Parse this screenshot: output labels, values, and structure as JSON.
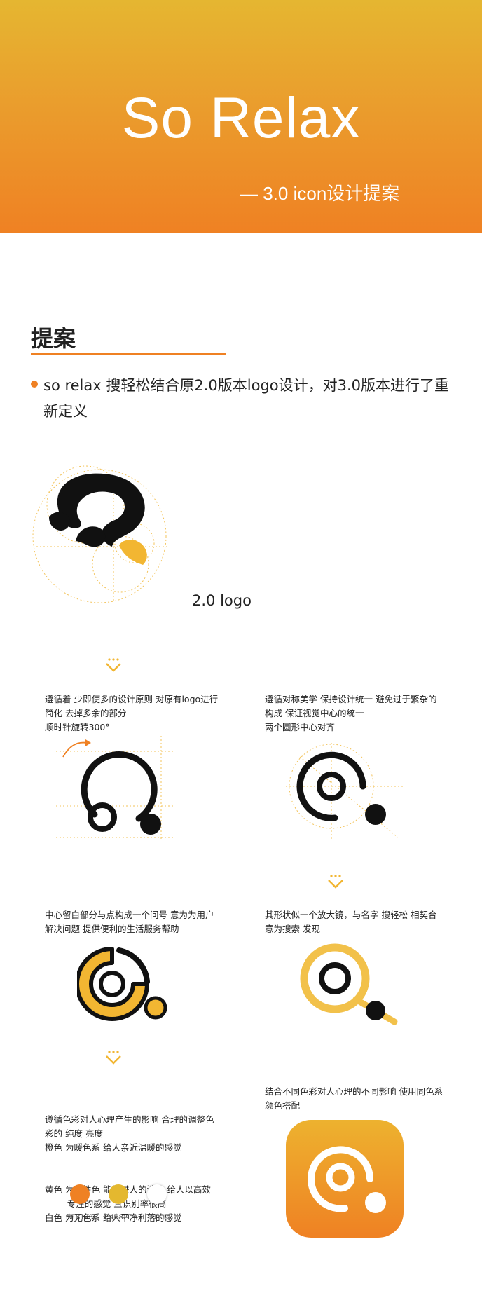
{
  "hero": {
    "title": "So Relax",
    "subtitle": "— 3.0 icon设计提案",
    "gradient": [
      "#E5B631",
      "#EF8123"
    ]
  },
  "section": {
    "title": "提案",
    "lead": "so relax 搜轻松结合原2.0版本logo设计，对3.0版本进行了重新定义"
  },
  "logo_caption": "2.0 logo",
  "steps": [
    {
      "id": "s1",
      "lines": [
        "遵循着 少即使多的设计原则 对原有logo进行",
        "简化 去掉多余的部分",
        "顺时针旋转300°"
      ]
    },
    {
      "id": "s2",
      "lines": [
        "遵循对称美学 保持设计统一 避免过于繁杂的",
        "构成 保证视觉中心的统一",
        "两个圆形中心对齐"
      ]
    },
    {
      "id": "s3",
      "lines": [
        "中心留白部分与点构成一个问号 意为为用户",
        "解决问题 提供便利的生活服务帮助"
      ]
    },
    {
      "id": "s4",
      "lines": [
        "其形状似一个放大镜，与名字 搜轻松 相契合",
        "意为搜索 发现"
      ]
    },
    {
      "id": "s5",
      "lines": [
        "遵循色彩对人心理产生的影响 合理的调整色",
        "彩的 纯度 亮度",
        "橙色 为暖色系 给人亲近温暖的感觉",
        "黄色 为中性色 能促进人的消费 给人以高效",
        "        专注的感觉 且识别率很高",
        "白色 为无色系 给人干净利落的感觉"
      ]
    },
    {
      "id": "s6",
      "lines": [
        "结合不同色彩对人心理的不同影响 使用同色系",
        "颜色搭配"
      ]
    }
  ],
  "palette": [
    {
      "hex": "EF8123",
      "color": "#EF8123"
    },
    {
      "hex": "E4B82F",
      "color": "#E4B82F"
    },
    {
      "hex": "FFFFFF",
      "color": "#FFFFFF"
    }
  ],
  "colors": {
    "orange": "#EF8123",
    "yellow": "#F2B632",
    "black": "#111111"
  },
  "icons": [
    "chevron-down-icon",
    "app-icon",
    "logo-2-0"
  ]
}
